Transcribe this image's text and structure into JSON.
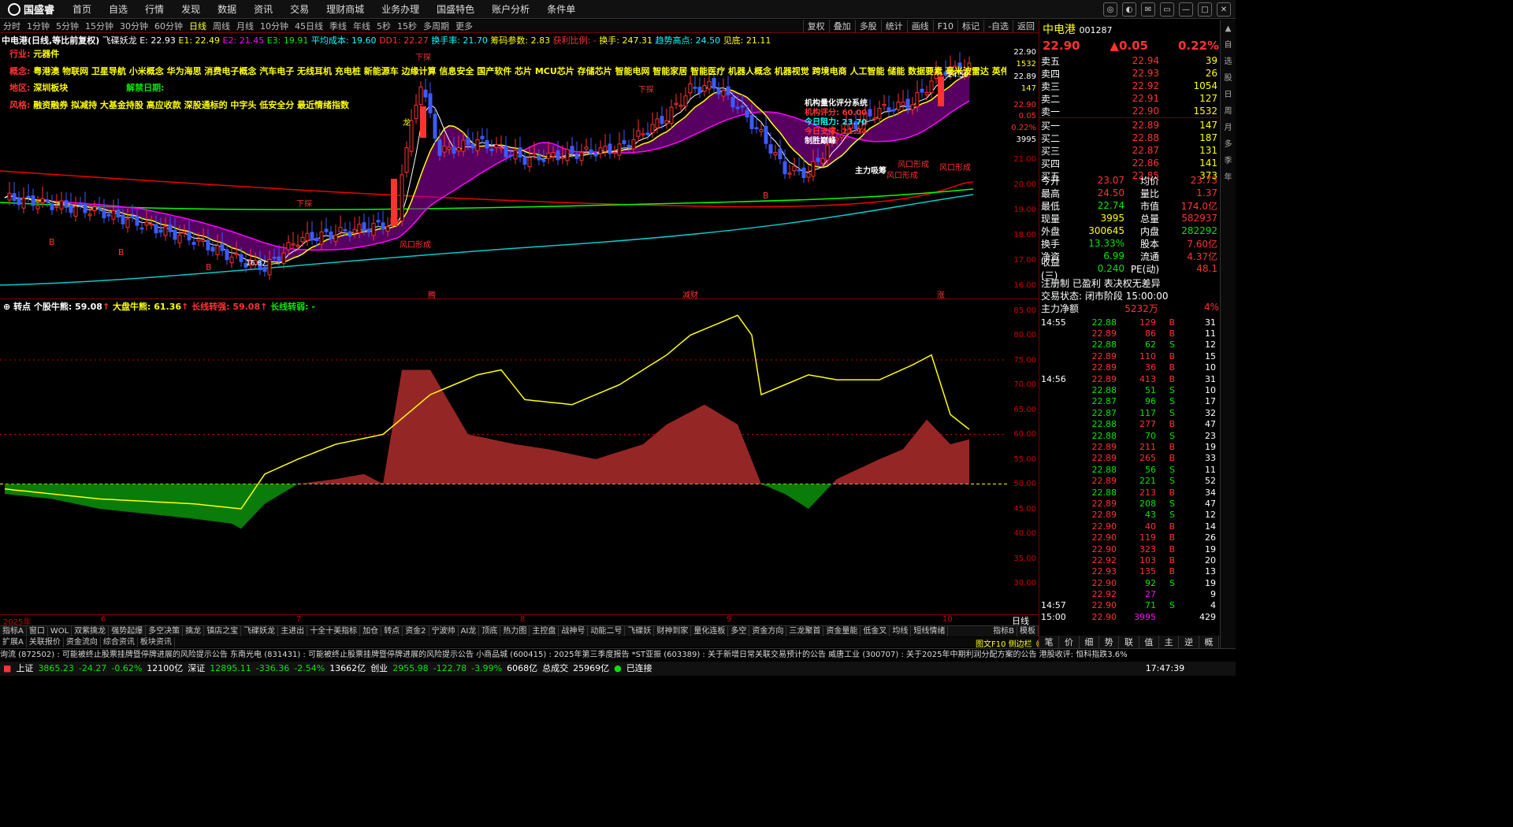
{
  "nav": {
    "logo": "国盛睿",
    "items": [
      "首页",
      "自选",
      "行情",
      "发现",
      "数据",
      "资讯",
      "交易",
      "理财商城",
      "业务办理",
      "国盛特色",
      "账户分析",
      "条件单"
    ]
  },
  "toolbar": {
    "periods": [
      "分时",
      "1分钟",
      "5分钟",
      "15分钟",
      "30分钟",
      "60分钟",
      "日线",
      "周线",
      "月线",
      "10分钟",
      "45日线",
      "季线",
      "年线",
      "5秒",
      "15秒",
      "多周期",
      "更多"
    ],
    "active": "日线",
    "right": [
      "复权",
      "叠加",
      "多股",
      "统计",
      "画线",
      "F10",
      "标记",
      "-自选",
      "返回"
    ]
  },
  "info": {
    "name": "中电港(日线,等比前复权)",
    "ind": "飞碟妖龙",
    "e": "E: 22.93",
    "e1": "E1: 22.49",
    "e2": "E2: 21.45",
    "e3": "E3: 19.91",
    "avg": "平均成本: 19.60",
    "dd1": "DD1: 22.27",
    "turn": "换手率: 21.70",
    "chip": "筹码参数: 2.83",
    "ratio": "获利比例: -",
    "hand": "换手: 247.31",
    "trend": "趋势高点: 24.50",
    "low": "见底: 21.11"
  },
  "concept": {
    "industry_label": "行业:",
    "industry": "元器件",
    "concept_label": "概念:",
    "concepts": "粤港澳 物联网 卫星导航 小米概念 华为海思 消费电子概念 汽车电子 无线耳机 充电桩 新能源车 边缘计算 信息安全 国产软件 芯片 MCU芯片 存储芯片 智能电网 智能家居 智能医疗 机器人概念 机器视觉 跨境电商 人工智能 储能 数据要素 毫米波雷达 英伟达概念 星闪概念",
    "region_label": "地区:",
    "region": "深圳板块",
    "unban_label": "解禁日期:",
    "style_label": "风格:",
    "style": "融资融券 拟减持 大基金持股 高应收款 深股通标的 中字头 低安全分 最近情绪指数"
  },
  "inst": {
    "title": "机构量化评分系统",
    "score": "机构评分:  60.00",
    "resist": "今日阻力:  23.70",
    "support": "今日支撑:  21.94",
    "win": "制胜巅峰"
  },
  "labels": {
    "xiacai": "下探",
    "fengkou": "风口形成",
    "zhuli": "主力吸筹",
    "low_mark": "16.87",
    "high_mark": "24.50",
    "long": "龙",
    "mark_b": "B",
    "bottom_marks": [
      "腾",
      "减财",
      "涨"
    ]
  },
  "axis_main": [
    "22.90",
    "1532",
    "22.89",
    "147",
    "22.90",
    "0.05",
    "0.22%",
    "3995",
    "21.00",
    "20.00",
    "19.00",
    "18.00",
    "17.00",
    "16.00"
  ],
  "indicator": {
    "name": "转点",
    "bull": "个股牛熊: 59.08",
    "market": "大盘牛熊: 61.36",
    "strong": "长线转强: 59.08",
    "weak": "长线转弱: -",
    "axis": [
      "85.00",
      "80.00",
      "75.00",
      "70.00",
      "65.00",
      "60.00",
      "55.00",
      "50.00",
      "45.00",
      "40.00",
      "35.00",
      "30.00"
    ]
  },
  "dates": [
    "2025年",
    "6",
    "7",
    "8",
    "9",
    "10"
  ],
  "date_right": "日线",
  "tabs1": [
    "指标A",
    "窗口",
    "WOL",
    "双紫擒龙",
    "强势起爆",
    "多空决策",
    "擒龙",
    "镇店之宝",
    "飞碟妖龙",
    "主进出",
    "十全十美指标",
    "加仓",
    "转点",
    "资金2",
    "宁波帅",
    "AI龙",
    "顶底",
    "热力图",
    "主控盘",
    "战神号",
    "动能二号",
    "飞碟妖",
    "财神到家",
    "量化连板",
    "多空",
    "资金方向",
    "三龙聚首",
    "资金量能",
    "低金叉",
    "均线",
    "短线情绪",
    "",
    "指标B",
    "模板"
  ],
  "tabs2": [
    "扩展A",
    "关联报价",
    "资金流向",
    "综合资讯",
    "板块资讯"
  ],
  "tabs2_right": "图文F10 侧边栏《",
  "news": "询流 (872502) : 可能被终止股票挂牌暨停牌进展的风险提示公告      东南光电 (831431) : 可能被终止股票挂牌暨停牌进展的风险提示公告      小商品城 (600415) : 2025年第三季度报告      *ST亚振 (603389) : 关于新增日常关联交易预计的公告      威唐工业 (300707) : 关于2025年中期利润分配方案的公告      港股收评: 恒科指跌3.6%",
  "status": {
    "sh_label": "上证",
    "sh": "3865.23",
    "sh_ch": "-24.27",
    "sh_pct": "-0.62%",
    "sh_vol": "12100亿",
    "sz_label": "深证",
    "sz": "12895.11",
    "sz_ch": "-336.36",
    "sz_pct": "-2.54%",
    "sz_vol": "13662亿",
    "cy_label": "创业",
    "cy": "2955.98",
    "cy_ch": "-122.78",
    "cy_pct": "-3.99%",
    "cy_vol": "6068亿",
    "total_label": "总成交",
    "total": "25969亿",
    "conn": "已连接",
    "time": "17:47:39"
  },
  "quote": {
    "name": "中电港",
    "code": "001287",
    "price": "22.90",
    "change": "▲0.05",
    "pct": "0.22%",
    "asks": [
      [
        "卖五",
        "22.94",
        "39"
      ],
      [
        "卖四",
        "22.93",
        "26"
      ],
      [
        "卖三",
        "22.92",
        "1054"
      ],
      [
        "卖二",
        "22.91",
        "127"
      ],
      [
        "卖一",
        "22.90",
        "1532"
      ]
    ],
    "bids": [
      [
        "买一",
        "22.89",
        "147"
      ],
      [
        "买二",
        "22.88",
        "187"
      ],
      [
        "买三",
        "22.87",
        "131"
      ],
      [
        "买四",
        "22.86",
        "141"
      ],
      [
        "买五",
        "22.85",
        "373"
      ]
    ],
    "stats": [
      [
        "今开",
        "23.07",
        "均价",
        "23.73"
      ],
      [
        "最高",
        "24.50",
        "量比",
        "1.37"
      ],
      [
        "最低",
        "22.74",
        "市值",
        "174.0亿"
      ],
      [
        "现量",
        "3995",
        "总量",
        "582937"
      ],
      [
        "外盘",
        "300645",
        "内盘",
        "282292"
      ]
    ],
    "stats2": [
      [
        "换手",
        "13.33%",
        "股本",
        "7.60亿"
      ],
      [
        "净资",
        "6.99",
        "流通",
        "4.37亿"
      ],
      [
        "收益(三)",
        "0.240",
        "PE(动)",
        "48.1"
      ]
    ],
    "reg": "注册制 已盈利 表决权无差异",
    "trade_state": "交易状态: 闭市阶段 15:00:00",
    "net_label": "主力净额",
    "net": "5232万",
    "net_pct": "4%",
    "ticks": [
      [
        "14:55",
        "22.88",
        "129",
        "B",
        "31"
      ],
      [
        "",
        "22.89",
        "86",
        "B",
        "11"
      ],
      [
        "",
        "22.88",
        "62",
        "S",
        "12"
      ],
      [
        "",
        "22.89",
        "110",
        "B",
        "15"
      ],
      [
        "",
        "22.89",
        "36",
        "B",
        "10"
      ],
      [
        "14:56",
        "22.89",
        "413",
        "B",
        "31"
      ],
      [
        "",
        "22.88",
        "51",
        "S",
        "10"
      ],
      [
        "",
        "22.87",
        "96",
        "S",
        "17"
      ],
      [
        "",
        "22.87",
        "117",
        "S",
        "32"
      ],
      [
        "",
        "22.88",
        "277",
        "B",
        "47"
      ],
      [
        "",
        "22.88",
        "70",
        "S",
        "23"
      ],
      [
        "",
        "22.89",
        "211",
        "B",
        "19"
      ],
      [
        "",
        "22.89",
        "265",
        "B",
        "33"
      ],
      [
        "",
        "22.88",
        "56",
        "S",
        "11"
      ],
      [
        "",
        "22.89",
        "221",
        "S",
        "52"
      ],
      [
        "",
        "22.88",
        "213",
        "B",
        "34"
      ],
      [
        "",
        "22.89",
        "208",
        "S",
        "47"
      ],
      [
        "",
        "22.89",
        "43",
        "S",
        "12"
      ],
      [
        "",
        "22.90",
        "40",
        "B",
        "14"
      ],
      [
        "",
        "22.90",
        "119",
        "B",
        "26"
      ],
      [
        "",
        "22.90",
        "323",
        "B",
        "19"
      ],
      [
        "",
        "22.92",
        "103",
        "B",
        "20"
      ],
      [
        "",
        "22.93",
        "135",
        "B",
        "13"
      ],
      [
        "",
        "22.90",
        "92",
        "S",
        "19"
      ],
      [
        "",
        "22.92",
        "27",
        "",
        "9"
      ],
      [
        "14:57",
        "22.90",
        "71",
        "S",
        "4"
      ],
      [
        "15:00",
        "22.90",
        "3995",
        "",
        "429"
      ]
    ],
    "bottom_tabs": [
      "笔",
      "价",
      "细",
      "势",
      "联",
      "值",
      "主",
      "逆",
      "概"
    ]
  },
  "sidebar": [
    "自",
    "选",
    "股",
    "日",
    "周",
    "月",
    "多",
    "季",
    "年"
  ],
  "colors": {
    "up": "#ff3232",
    "down": "#00e600",
    "yellow": "#ffff00",
    "cyan": "#00ffff",
    "magenta": "#ff00ff"
  }
}
